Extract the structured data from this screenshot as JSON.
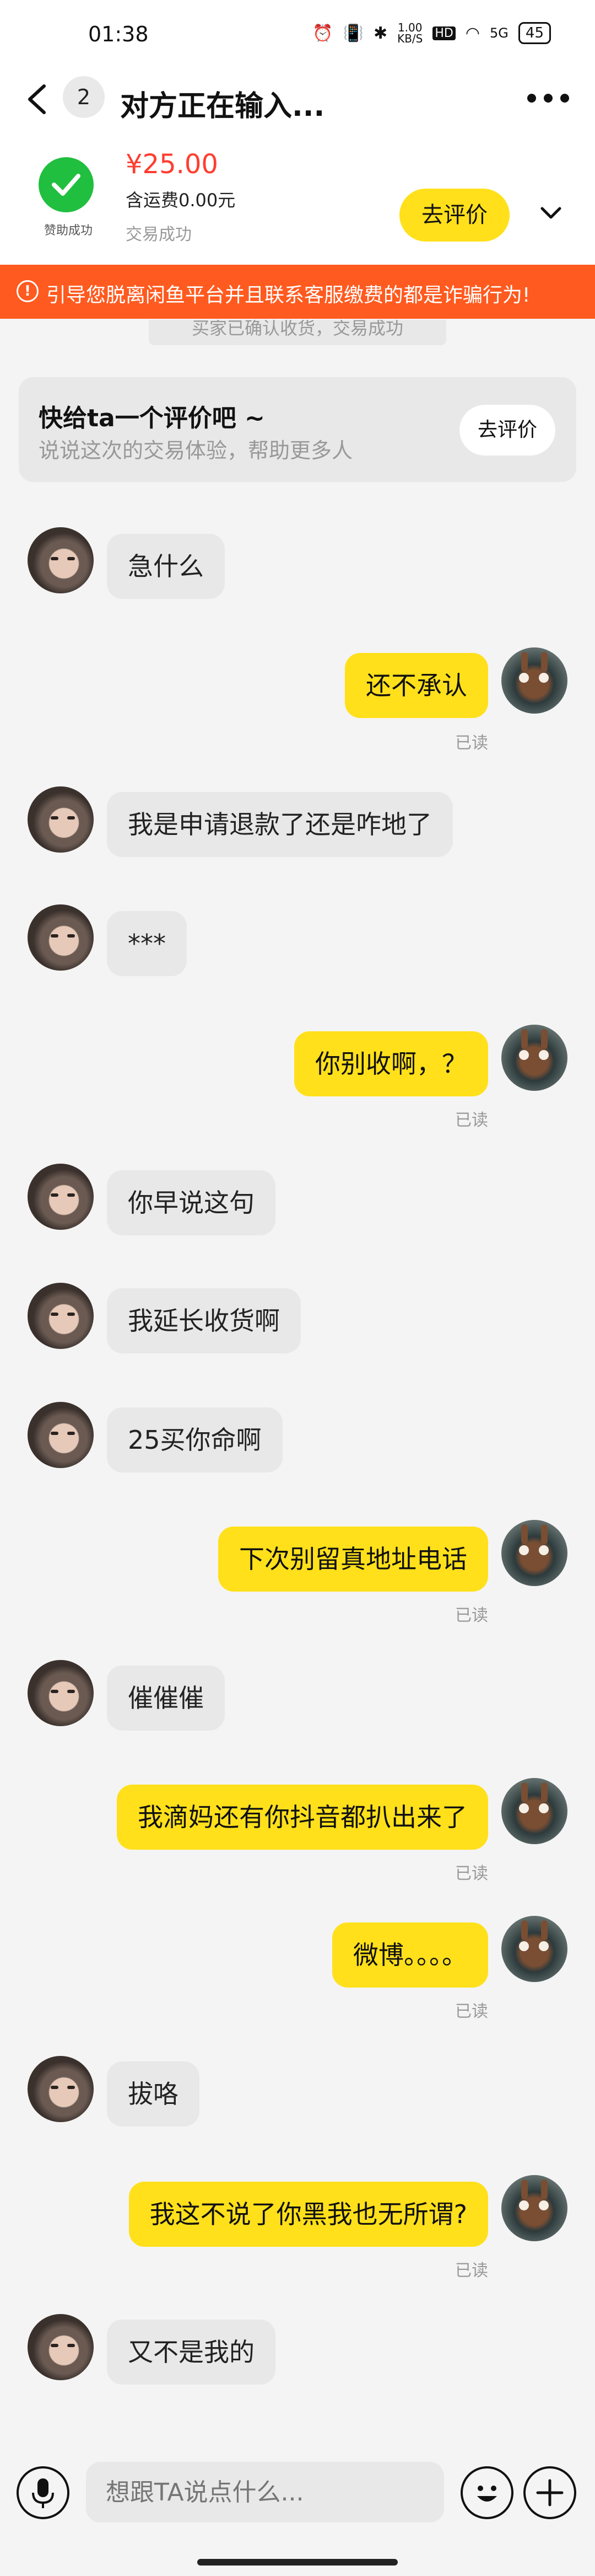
{
  "status_bar": {
    "time": "01:38",
    "net_speed_top": "1.00",
    "net_speed_bottom": "KB/S",
    "hd": "HD",
    "signal": "5G",
    "battery": "45"
  },
  "header": {
    "unread_count": "2",
    "title": "对方正在输入..."
  },
  "order": {
    "badge_text": "赞助成功",
    "price": "¥25.00",
    "shipping": "含运费0.00元",
    "status": "交易成功",
    "review_button": "去评价"
  },
  "banner": {
    "text": "引导您脱离闲鱼平台并且联系客服缴费的都是诈骗行为!"
  },
  "system_msg": "买家已确认收货，交易成功",
  "review_prompt": {
    "title": "快给ta一个评价吧 ~",
    "subtitle": "说说这次的交易体验，帮助更多人",
    "button": "去评价"
  },
  "messages": [
    {
      "side": "left",
      "text": "急什么"
    },
    {
      "side": "right",
      "text": "还不承认",
      "status": "已读"
    },
    {
      "side": "left",
      "text": "我是申请退款了还是咋地了"
    },
    {
      "side": "left",
      "text": "***"
    },
    {
      "side": "right",
      "text": "你别收啊，？",
      "status": "已读"
    },
    {
      "side": "left",
      "text": "你早说这句"
    },
    {
      "side": "left",
      "text": "我延长收货啊"
    },
    {
      "side": "left",
      "text": "25买你命啊"
    },
    {
      "side": "right",
      "text": "下次别留真地址电话",
      "status": "已读"
    },
    {
      "side": "left",
      "text": "催催催"
    },
    {
      "side": "right",
      "text": "我滴妈还有你抖音都扒出来了",
      "status": "已读"
    },
    {
      "side": "right",
      "text": "微博。。。。",
      "status": "已读"
    },
    {
      "side": "left",
      "text": "拔咯"
    },
    {
      "side": "right",
      "text": "我这不说了你黑我也无所谓?",
      "status": "已读"
    },
    {
      "side": "left",
      "text": "又不是我的"
    }
  ],
  "input": {
    "placeholder": "想跟TA说点什么..."
  },
  "colors": {
    "accent_yellow": "#ffe01b",
    "warning_orange": "#ff5a1f",
    "price_red": "#ff3d2e",
    "success_green": "#20bf3f"
  }
}
